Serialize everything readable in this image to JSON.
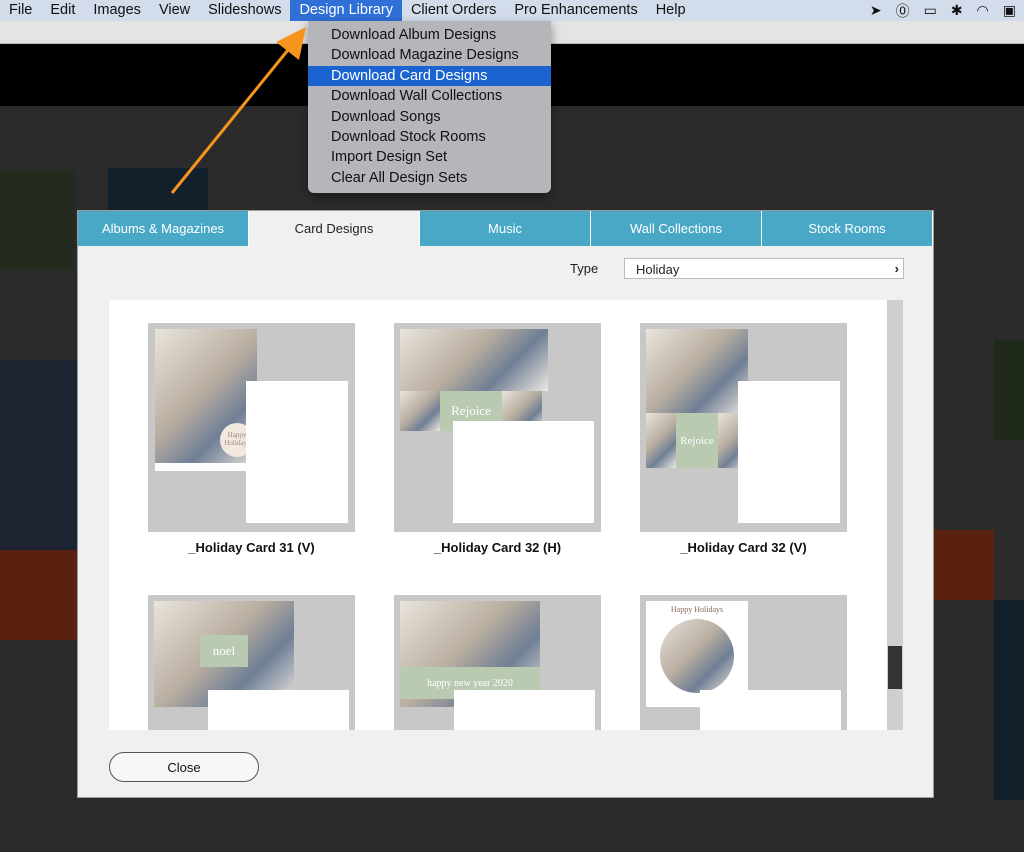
{
  "menubar": {
    "items": [
      "File",
      "Edit",
      "Images",
      "View",
      "Slideshows",
      "Design Library",
      "Client Orders",
      "Pro Enhancements",
      "Help"
    ],
    "active": "Design Library",
    "status_icons": [
      "arrow-icon",
      "1password-icon",
      "airplay-icon",
      "bluetooth-icon",
      "wifi-icon",
      "battery-icon"
    ]
  },
  "menu": {
    "items": [
      "Download Album Designs",
      "Download Magazine Designs",
      "Download Card Designs",
      "Download Wall Collections",
      "Download Songs",
      "Download Stock Rooms",
      "Import Design Set",
      "Clear All Design Sets"
    ],
    "highlighted": "Download Card Designs"
  },
  "dialog": {
    "tabs": [
      "Albums & Magazines",
      "Card Designs",
      "Music",
      "Wall Collections",
      "Stock Rooms"
    ],
    "selected_tab": "Card Designs",
    "type_label": "Type",
    "type_value": "Holiday",
    "cards": [
      {
        "label": "_Holiday Card 31 (V)",
        "text": "Happy Holidays"
      },
      {
        "label": "_Holiday Card 32 (H)",
        "text": "Rejoice"
      },
      {
        "label": "_Holiday Card 32 (V)",
        "text": "Rejoice"
      },
      {
        "label": "",
        "text": "noel"
      },
      {
        "label": "",
        "text": "happy new year 2020"
      },
      {
        "label": "",
        "text": "Happy Holidays"
      }
    ],
    "close_label": "Close"
  },
  "colors": {
    "tab": "#4aa8c7",
    "menu_highlight": "#1b63d0",
    "arrow": "#f7941d"
  }
}
